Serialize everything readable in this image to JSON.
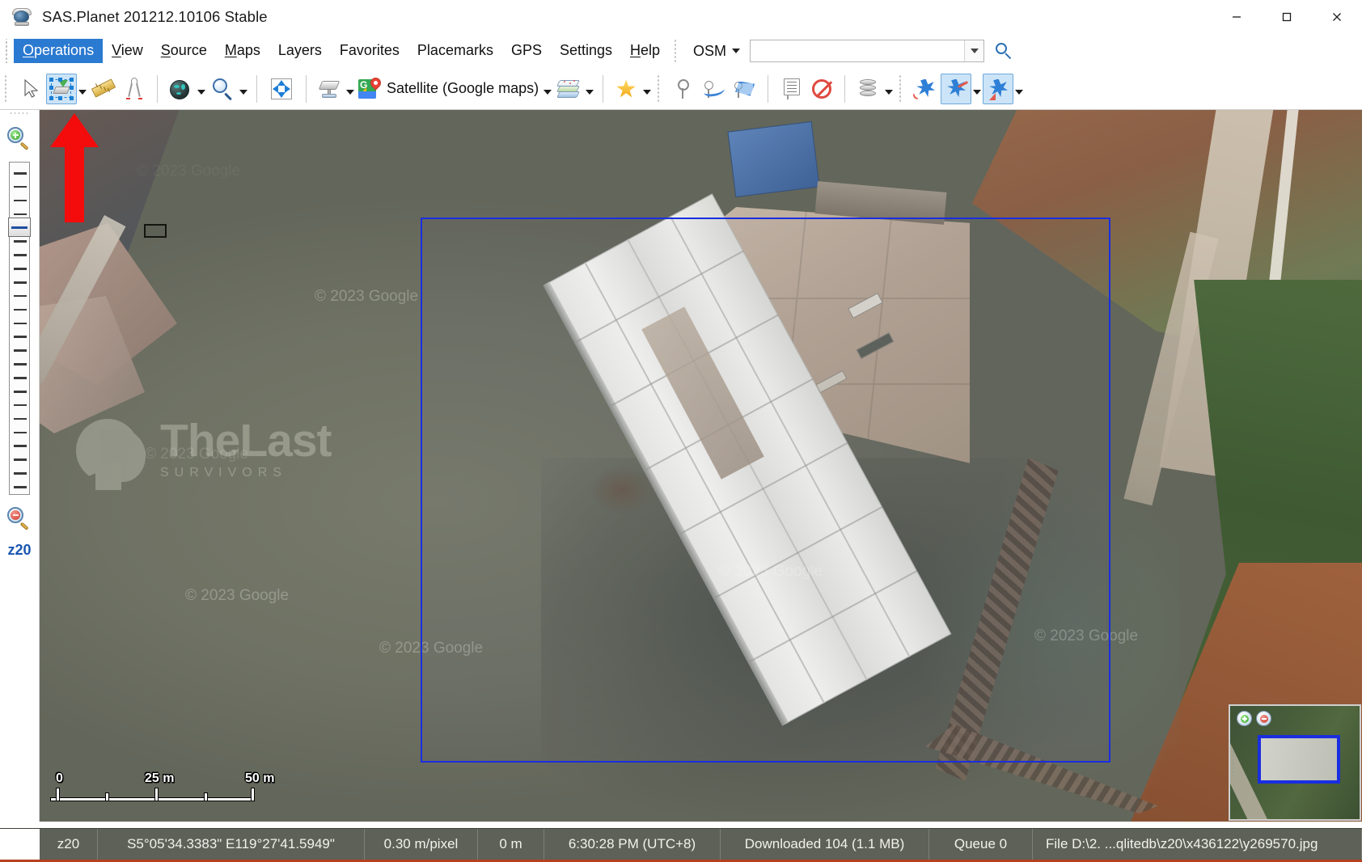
{
  "window": {
    "title": "SAS.Planet 201212.10106 Stable",
    "app_icon": "sas-planet-globe-icon",
    "controls": {
      "minimize": "—",
      "maximize": "☐",
      "close": "✕"
    }
  },
  "menubar": {
    "items": [
      {
        "label": "Operations",
        "mnemonic": "O",
        "active": true
      },
      {
        "label": "View",
        "mnemonic": "V",
        "active": false
      },
      {
        "label": "Source",
        "mnemonic": "S",
        "active": false
      },
      {
        "label": "Maps",
        "mnemonic": "M",
        "active": false
      },
      {
        "label": "Layers",
        "mnemonic": "",
        "active": false
      },
      {
        "label": "Favorites",
        "mnemonic": "",
        "active": false
      },
      {
        "label": "Placemarks",
        "mnemonic": "",
        "active": false
      },
      {
        "label": "GPS",
        "mnemonic": "",
        "active": false
      },
      {
        "label": "Settings",
        "mnemonic": "",
        "active": false
      },
      {
        "label": "Help",
        "mnemonic": "H",
        "active": false
      }
    ],
    "search": {
      "provider_label": "OSM",
      "value": "",
      "placeholder": ""
    }
  },
  "toolbar": {
    "groups": [
      {
        "name": "selection-tools",
        "buttons": [
          {
            "name": "pointer-tool",
            "icon": "cursor-arrow-icon",
            "label": "",
            "selected": false,
            "dropdown": false
          },
          {
            "name": "rect-selection-tool",
            "icon": "rect-selection-icon",
            "label": "",
            "selected": true,
            "dropdown": true
          },
          {
            "name": "ruler-tool",
            "icon": "ruler-icon",
            "label": "",
            "selected": false,
            "dropdown": false
          },
          {
            "name": "calibration-tool",
            "icon": "compass-divider-icon",
            "label": "",
            "selected": false,
            "dropdown": false
          }
        ]
      },
      {
        "name": "view-tools",
        "buttons": [
          {
            "name": "goto-coordinates",
            "icon": "dark-globe-icon",
            "label": "",
            "selected": false,
            "dropdown": true
          },
          {
            "name": "zoom-tool",
            "icon": "magnifier-icon",
            "label": "",
            "selected": false,
            "dropdown": true
          }
        ]
      },
      {
        "name": "fullscreen-group",
        "buttons": [
          {
            "name": "fullscreen-toggle",
            "icon": "fullscreen-arrows-icon",
            "label": "",
            "selected": false,
            "dropdown": false
          }
        ]
      },
      {
        "name": "source-group",
        "buttons": [
          {
            "name": "cache-source-select",
            "icon": "server-cache-icon",
            "label": "",
            "selected": false,
            "dropdown": true
          },
          {
            "name": "map-source-select",
            "icon": "google-maps-icon",
            "label": "Satellite (Google maps)",
            "selected": false,
            "dropdown": true
          },
          {
            "name": "layers-select",
            "icon": "layers-stack-icon",
            "label": "",
            "selected": false,
            "dropdown": true
          }
        ]
      },
      {
        "name": "favorites-group",
        "buttons": [
          {
            "name": "favorites-button",
            "icon": "star-icon",
            "label": "",
            "selected": false,
            "dropdown": true
          }
        ]
      },
      {
        "name": "placemark-group",
        "buttons": [
          {
            "name": "add-placemark",
            "icon": "placemark-pin-icon",
            "label": "",
            "selected": false,
            "dropdown": false
          },
          {
            "name": "add-path",
            "icon": "path-curve-icon",
            "label": "",
            "selected": false,
            "dropdown": false
          },
          {
            "name": "add-polygon",
            "icon": "polygon-icon",
            "label": "",
            "selected": false,
            "dropdown": false
          }
        ]
      },
      {
        "name": "info-group",
        "buttons": [
          {
            "name": "placemark-manager",
            "icon": "note-list-icon",
            "label": "",
            "selected": false,
            "dropdown": false
          },
          {
            "name": "disable-tile-fill",
            "icon": "no-entry-icon",
            "label": "",
            "selected": false,
            "dropdown": false
          }
        ]
      },
      {
        "name": "cache-group",
        "buttons": [
          {
            "name": "cache-manager",
            "icon": "database-icon",
            "label": "",
            "selected": false,
            "dropdown": true
          }
        ]
      },
      {
        "name": "gps-group",
        "buttons": [
          {
            "name": "gps-connect",
            "icon": "gps-satellite-icon",
            "label": "",
            "selected": false,
            "dropdown": false
          },
          {
            "name": "gps-track-recording",
            "icon": "gps-satellite-track-icon",
            "label": "",
            "selected": true,
            "dropdown": true
          },
          {
            "name": "gps-center-map",
            "icon": "gps-satellite-center-icon",
            "label": "",
            "selected": true,
            "dropdown": true
          }
        ]
      }
    ]
  },
  "zoom_panel": {
    "zoom_in_icon": "magnifier-plus-icon",
    "zoom_out_icon": "magnifier-minus-icon",
    "slider_ticks": 24,
    "current_zoom_label": "z20",
    "thumb_position_index": 4
  },
  "map": {
    "scale_bar": {
      "labels": [
        "0",
        "25 m",
        "50 m"
      ],
      "unit": "m",
      "max_value": 50
    },
    "attribution_watermarks": [
      "© 2023 Google",
      "© 2023 Google",
      "© 2023 Google",
      "© 2023 Google",
      "© 2023 Google"
    ],
    "overlay_watermark": {
      "title": "TheLast",
      "subtitle": "SURVIVORS"
    },
    "selection_rectangle": {
      "present": true,
      "color": "#1a2ee0"
    },
    "marker_rectangle": {
      "present": true,
      "color": "#15150f"
    },
    "annotation_arrow": {
      "present": true,
      "color": "#f40b0b",
      "direction": "up"
    }
  },
  "minimap": {
    "zoom_in_icon": "minimap-zoom-in-icon",
    "zoom_out_icon": "minimap-zoom-out-icon",
    "viewport_rect_color": "#1a2ee0"
  },
  "statusbar": {
    "cells": [
      {
        "name": "status-zoom",
        "value": "z20"
      },
      {
        "name": "status-coordinates",
        "value": "S5°05'34.3383\" E119°27'41.5949\""
      },
      {
        "name": "status-resolution",
        "value": "0.30 m/pixel"
      },
      {
        "name": "status-elevation",
        "value": "0 m"
      },
      {
        "name": "status-time",
        "value": "6:30:28 PM (UTC+8)"
      },
      {
        "name": "status-downloaded",
        "value": "Downloaded 104 (1.1 MB)"
      },
      {
        "name": "status-queue",
        "value": "Queue 0"
      },
      {
        "name": "status-file",
        "value": "File D:\\2. ...qlitedb\\z20\\x436122\\y269570.jpg"
      }
    ]
  },
  "colors": {
    "menu_active_bg": "#2b7ad1",
    "toolbar_selected_bg": "#cce4f7",
    "statusbar_bg": "#5e6157",
    "statusbar_accent": "#b4421f",
    "zoom_label": "#1a56b0",
    "selection_blue": "#1a2ee0",
    "annotation_red": "#f40b0b"
  }
}
